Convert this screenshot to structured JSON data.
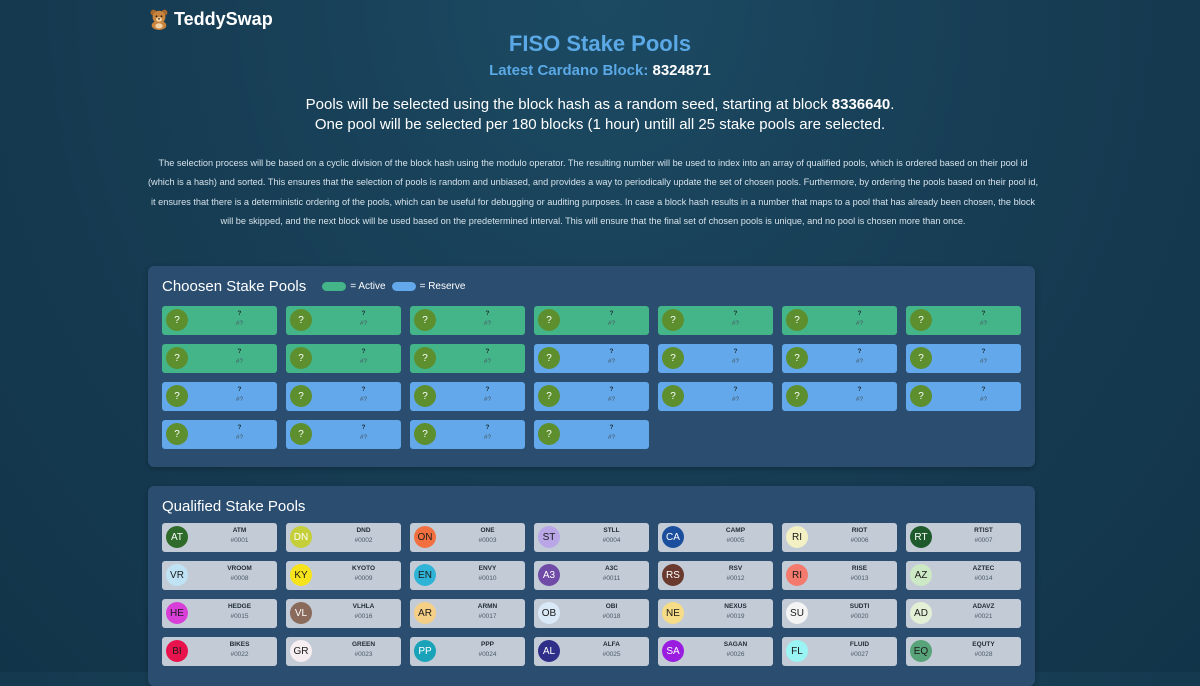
{
  "brand": {
    "name": "TeddySwap"
  },
  "header": {
    "title": "FISO Stake Pools",
    "block_label": "Latest Cardano Block:",
    "block_number": "8324871"
  },
  "selection": {
    "line1_pre": "Pools will be selected using the block hash as a random seed, starting at block ",
    "start_block": "8336640",
    "line1_post": ".",
    "line2": "One pool will be selected per 180 blocks (1 hour) untill all 25 stake pools are selected."
  },
  "description": "The selection process will be based on a cyclic division of the block hash using the modulo operator. The resulting number will be used to index into an array of qualified pools, which is ordered based on their pool id (which is a hash) and sorted. This ensures that the selection of pools is random and unbiased, and provides a way to periodically update the set of chosen pools. Furthermore, by ordering the pools based on their pool id, it ensures that there is a deterministic ordering of the pools, which can be useful for debugging or auditing purposes. In case a block hash results in a number that maps to a pool that has already been chosen, the block will be skipped, and the next block will be used based on the predetermined interval. This will ensure that the final set of chosen pools is unique, and no pool is chosen more than once.",
  "chosen": {
    "title": "Choosen Stake Pools",
    "legend_active": "= Active",
    "legend_reserve": "= Reserve",
    "colors": {
      "active": "#43b589",
      "reserve": "#62a8ea"
    },
    "pools": [
      {
        "avatar": "?",
        "ticker": "?",
        "id": "#?",
        "status": "active"
      },
      {
        "avatar": "?",
        "ticker": "?",
        "id": "#?",
        "status": "active"
      },
      {
        "avatar": "?",
        "ticker": "?",
        "id": "#?",
        "status": "active"
      },
      {
        "avatar": "?",
        "ticker": "?",
        "id": "#?",
        "status": "active"
      },
      {
        "avatar": "?",
        "ticker": "?",
        "id": "#?",
        "status": "active"
      },
      {
        "avatar": "?",
        "ticker": "?",
        "id": "#?",
        "status": "active"
      },
      {
        "avatar": "?",
        "ticker": "?",
        "id": "#?",
        "status": "active"
      },
      {
        "avatar": "?",
        "ticker": "?",
        "id": "#?",
        "status": "active"
      },
      {
        "avatar": "?",
        "ticker": "?",
        "id": "#?",
        "status": "active"
      },
      {
        "avatar": "?",
        "ticker": "?",
        "id": "#?",
        "status": "active"
      },
      {
        "avatar": "?",
        "ticker": "?",
        "id": "#?",
        "status": "reserve"
      },
      {
        "avatar": "?",
        "ticker": "?",
        "id": "#?",
        "status": "reserve"
      },
      {
        "avatar": "?",
        "ticker": "?",
        "id": "#?",
        "status": "reserve"
      },
      {
        "avatar": "?",
        "ticker": "?",
        "id": "#?",
        "status": "reserve"
      },
      {
        "avatar": "?",
        "ticker": "?",
        "id": "#?",
        "status": "reserve"
      },
      {
        "avatar": "?",
        "ticker": "?",
        "id": "#?",
        "status": "reserve"
      },
      {
        "avatar": "?",
        "ticker": "?",
        "id": "#?",
        "status": "reserve"
      },
      {
        "avatar": "?",
        "ticker": "?",
        "id": "#?",
        "status": "reserve"
      },
      {
        "avatar": "?",
        "ticker": "?",
        "id": "#?",
        "status": "reserve"
      },
      {
        "avatar": "?",
        "ticker": "?",
        "id": "#?",
        "status": "reserve"
      },
      {
        "avatar": "?",
        "ticker": "?",
        "id": "#?",
        "status": "reserve"
      },
      {
        "avatar": "?",
        "ticker": "?",
        "id": "#?",
        "status": "reserve"
      },
      {
        "avatar": "?",
        "ticker": "?",
        "id": "#?",
        "status": "reserve"
      },
      {
        "avatar": "?",
        "ticker": "?",
        "id": "#?",
        "status": "reserve"
      },
      {
        "avatar": "?",
        "ticker": "?",
        "id": "#?",
        "status": "reserve"
      }
    ]
  },
  "qualified": {
    "title": "Qualified Stake Pools",
    "pools": [
      {
        "avatar": "AT",
        "ticker": "ATM",
        "id": "#0001",
        "color": "#2e6b2a",
        "text": "#ffffff"
      },
      {
        "avatar": "DN",
        "ticker": "DND",
        "id": "#0002",
        "color": "#c5cf3a",
        "text": "#ffffff"
      },
      {
        "avatar": "ON",
        "ticker": "ONE",
        "id": "#0003",
        "color": "#f2703f",
        "text": "#1a1a1a"
      },
      {
        "avatar": "ST",
        "ticker": "STLL",
        "id": "#0004",
        "color": "#b8a6e6",
        "text": "#1a1a1a"
      },
      {
        "avatar": "CA",
        "ticker": "CAMP",
        "id": "#0005",
        "color": "#1b4f9e",
        "text": "#ffffff"
      },
      {
        "avatar": "RI",
        "ticker": "RIOT",
        "id": "#0006",
        "color": "#f3f1c4",
        "text": "#1a1a1a"
      },
      {
        "avatar": "RT",
        "ticker": "RTIST",
        "id": "#0007",
        "color": "#1f5a2c",
        "text": "#ffffff"
      },
      {
        "avatar": "VR",
        "ticker": "VROOM",
        "id": "#0008",
        "color": "#bfe3f4",
        "text": "#1a1a1a"
      },
      {
        "avatar": "KY",
        "ticker": "KYOTO",
        "id": "#0009",
        "color": "#f7e31c",
        "text": "#1a1a1a"
      },
      {
        "avatar": "EN",
        "ticker": "ENVY",
        "id": "#0010",
        "color": "#2fb3d6",
        "text": "#1a1a1a"
      },
      {
        "avatar": "A3",
        "ticker": "A3C",
        "id": "#0011",
        "color": "#6f4aa6",
        "text": "#ffffff"
      },
      {
        "avatar": "RS",
        "ticker": "RSV",
        "id": "#0012",
        "color": "#6b3a2e",
        "text": "#ffffff"
      },
      {
        "avatar": "RI",
        "ticker": "RISE",
        "id": "#0013",
        "color": "#f47a6e",
        "text": "#1a1a1a"
      },
      {
        "avatar": "AZ",
        "ticker": "AZTEC",
        "id": "#0014",
        "color": "#cde8c4",
        "text": "#1a1a1a"
      },
      {
        "avatar": "HE",
        "ticker": "HEDGE",
        "id": "#0015",
        "color": "#d83fd8",
        "text": "#1a1a1a"
      },
      {
        "avatar": "VL",
        "ticker": "VLHLA",
        "id": "#0016",
        "color": "#8a6a5a",
        "text": "#ffffff"
      },
      {
        "avatar": "AR",
        "ticker": "ARMN",
        "id": "#0017",
        "color": "#f5cf86",
        "text": "#1a1a1a"
      },
      {
        "avatar": "OB",
        "ticker": "OBI",
        "id": "#0018",
        "color": "#d9e9f7",
        "text": "#1a1a1a"
      },
      {
        "avatar": "NE",
        "ticker": "NEXUS",
        "id": "#0019",
        "color": "#f6dc86",
        "text": "#1a1a1a"
      },
      {
        "avatar": "SU",
        "ticker": "SUDTI",
        "id": "#0020",
        "color": "#f4f4f4",
        "text": "#1a1a1a"
      },
      {
        "avatar": "AD",
        "ticker": "ADAVZ",
        "id": "#0021",
        "color": "#e3f0d6",
        "text": "#1a1a1a"
      },
      {
        "avatar": "BI",
        "ticker": "BIKES",
        "id": "#0022",
        "color": "#e8134c",
        "text": "#1a1a1a"
      },
      {
        "avatar": "GR",
        "ticker": "GREEN",
        "id": "#0023",
        "color": "#f7eef2",
        "text": "#1a1a1a"
      },
      {
        "avatar": "PP",
        "ticker": "PPP",
        "id": "#0024",
        "color": "#1aa3b8",
        "text": "#ffffff"
      },
      {
        "avatar": "AL",
        "ticker": "ALFA",
        "id": "#0025",
        "color": "#2f2f8a",
        "text": "#ffffff"
      },
      {
        "avatar": "SA",
        "ticker": "SAGAN",
        "id": "#0026",
        "color": "#9a1ce0",
        "text": "#ffffff"
      },
      {
        "avatar": "FL",
        "ticker": "FLUID",
        "id": "#0027",
        "color": "#9af4f4",
        "text": "#1a1a1a"
      },
      {
        "avatar": "EQ",
        "ticker": "EQUTY",
        "id": "#0028",
        "color": "#58a37a",
        "text": "#1a1a1a"
      }
    ]
  }
}
